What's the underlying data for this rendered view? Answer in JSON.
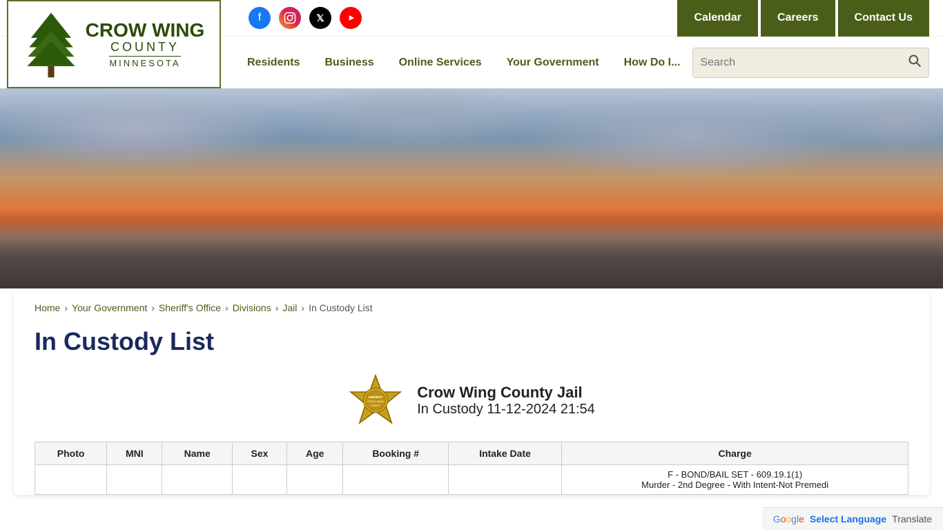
{
  "site": {
    "name": "Crow Wing County Minnesota",
    "logo_line1": "CROW WING",
    "logo_line2": "COUNTY",
    "logo_line3": "MINNESOTA"
  },
  "topbar": {
    "calendar_label": "Calendar",
    "careers_label": "Careers",
    "contact_label": "Contact Us"
  },
  "social": {
    "facebook_label": "f",
    "instagram_label": "📷",
    "x_label": "𝕏",
    "youtube_label": "▶"
  },
  "nav": {
    "residents_label": "Residents",
    "business_label": "Business",
    "online_services_label": "Online Services",
    "your_government_label": "Your Government",
    "how_do_i_label": "How Do I..."
  },
  "search": {
    "placeholder": "Search"
  },
  "breadcrumb": {
    "home": "Home",
    "your_government": "Your Government",
    "sheriffs_office": "Sheriff's Office",
    "divisions": "Divisions",
    "jail": "Jail",
    "current": "In Custody List"
  },
  "page": {
    "title": "In Custody List"
  },
  "jail_report": {
    "name": "Crow Wing County Jail",
    "timestamp": "In Custody 11-12-2024 21:54"
  },
  "table": {
    "headers": [
      "Photo",
      "MNI",
      "Name",
      "Sex",
      "Age",
      "Booking #",
      "Intake Date",
      "Charge"
    ],
    "first_charge_bond": "F  -  BOND/BAIL SET        -  609.19.1(1)",
    "first_charge_desc": "Murder - 2nd Degree - With Intent-Not Premedi"
  },
  "footer": {
    "select_language": "Select Language",
    "translate_label": "Translate"
  }
}
